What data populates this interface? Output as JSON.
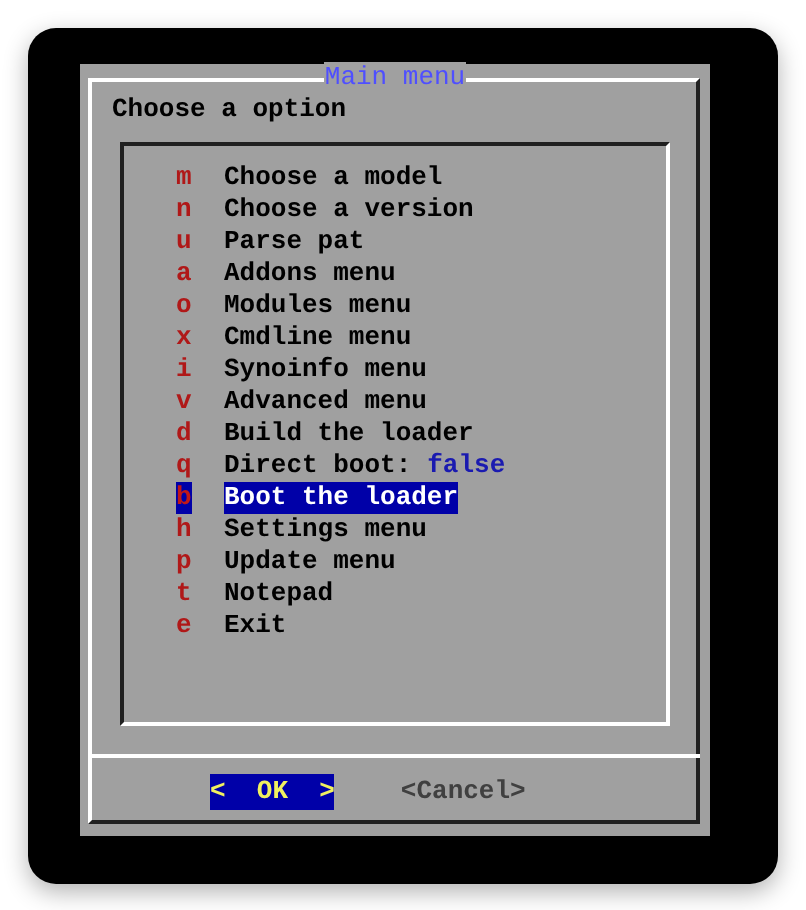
{
  "dialog": {
    "title": "Main menu",
    "prompt": "Choose a option"
  },
  "menu_items": [
    {
      "key": "m",
      "label": "Choose a model",
      "selected": false
    },
    {
      "key": "n",
      "label": "Choose a version",
      "selected": false
    },
    {
      "key": "u",
      "label": "Parse pat",
      "selected": false
    },
    {
      "key": "a",
      "label": "Addons menu",
      "selected": false
    },
    {
      "key": "o",
      "label": "Modules menu",
      "selected": false
    },
    {
      "key": "x",
      "label": "Cmdline menu",
      "selected": false
    },
    {
      "key": "i",
      "label": "Synoinfo menu",
      "selected": false
    },
    {
      "key": "v",
      "label": "Advanced menu",
      "selected": false
    },
    {
      "key": "d",
      "label": "Build the loader",
      "selected": false
    },
    {
      "key": "q",
      "label": "Direct boot:",
      "value": "false",
      "selected": false
    },
    {
      "key": "b",
      "label": "Boot the loader",
      "selected": true
    },
    {
      "key": "h",
      "label": "Settings menu",
      "selected": false
    },
    {
      "key": "p",
      "label": "Update menu",
      "selected": false
    },
    {
      "key": "t",
      "label": "Notepad",
      "selected": false
    },
    {
      "key": "e",
      "label": "Exit",
      "selected": false
    }
  ],
  "buttons": [
    {
      "label": "<  OK  >",
      "selected": true
    },
    {
      "label": "<Cancel>",
      "selected": false
    }
  ]
}
